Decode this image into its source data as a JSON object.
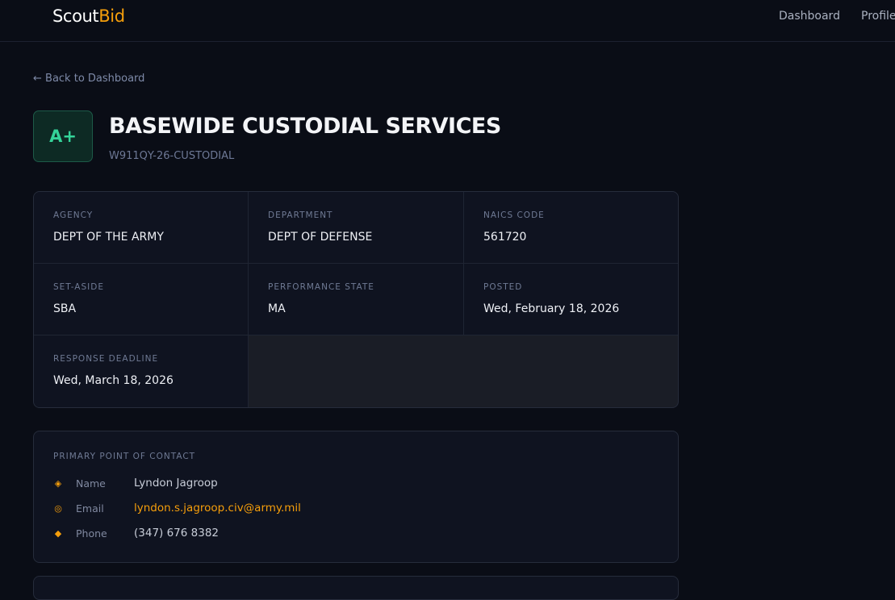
{
  "brand": {
    "part1": "Scout",
    "part2": "Bid",
    "accent": "#f59e0b"
  },
  "nav": {
    "dashboard": "Dashboard",
    "profile": "Profile"
  },
  "back_link": "← Back to Dashboard",
  "opportunity": {
    "grade": "A+",
    "title": "BASEWIDE CUSTODIAL SERVICES",
    "solicitation": "W911QY-26-CUSTODIAL"
  },
  "details": [
    {
      "label": "AGENCY",
      "value": "DEPT OF THE ARMY"
    },
    {
      "label": "DEPARTMENT",
      "value": "DEPT OF DEFENSE"
    },
    {
      "label": "NAICS CODE",
      "value": "561720"
    },
    {
      "label": "SET-ASIDE",
      "value": "SBA"
    },
    {
      "label": "PERFORMANCE STATE",
      "value": "MA"
    },
    {
      "label": "POSTED",
      "value": "Wed, February 18, 2026"
    },
    {
      "label": "RESPONSE DEADLINE",
      "value": "Wed, March 18, 2026"
    }
  ],
  "contact": {
    "title": "PRIMARY POINT OF CONTACT",
    "rows": [
      {
        "icon": "◈",
        "icon_name": "name-icon",
        "key": "Name",
        "value": "Lyndon Jagroop"
      },
      {
        "icon": "◎",
        "icon_name": "email-icon",
        "key": "Email",
        "value": "lyndon.s.jagroop.civ@army.mil"
      },
      {
        "icon": "◆",
        "icon_name": "phone-icon",
        "key": "Phone",
        "value": "(347) 676 8382"
      }
    ]
  }
}
